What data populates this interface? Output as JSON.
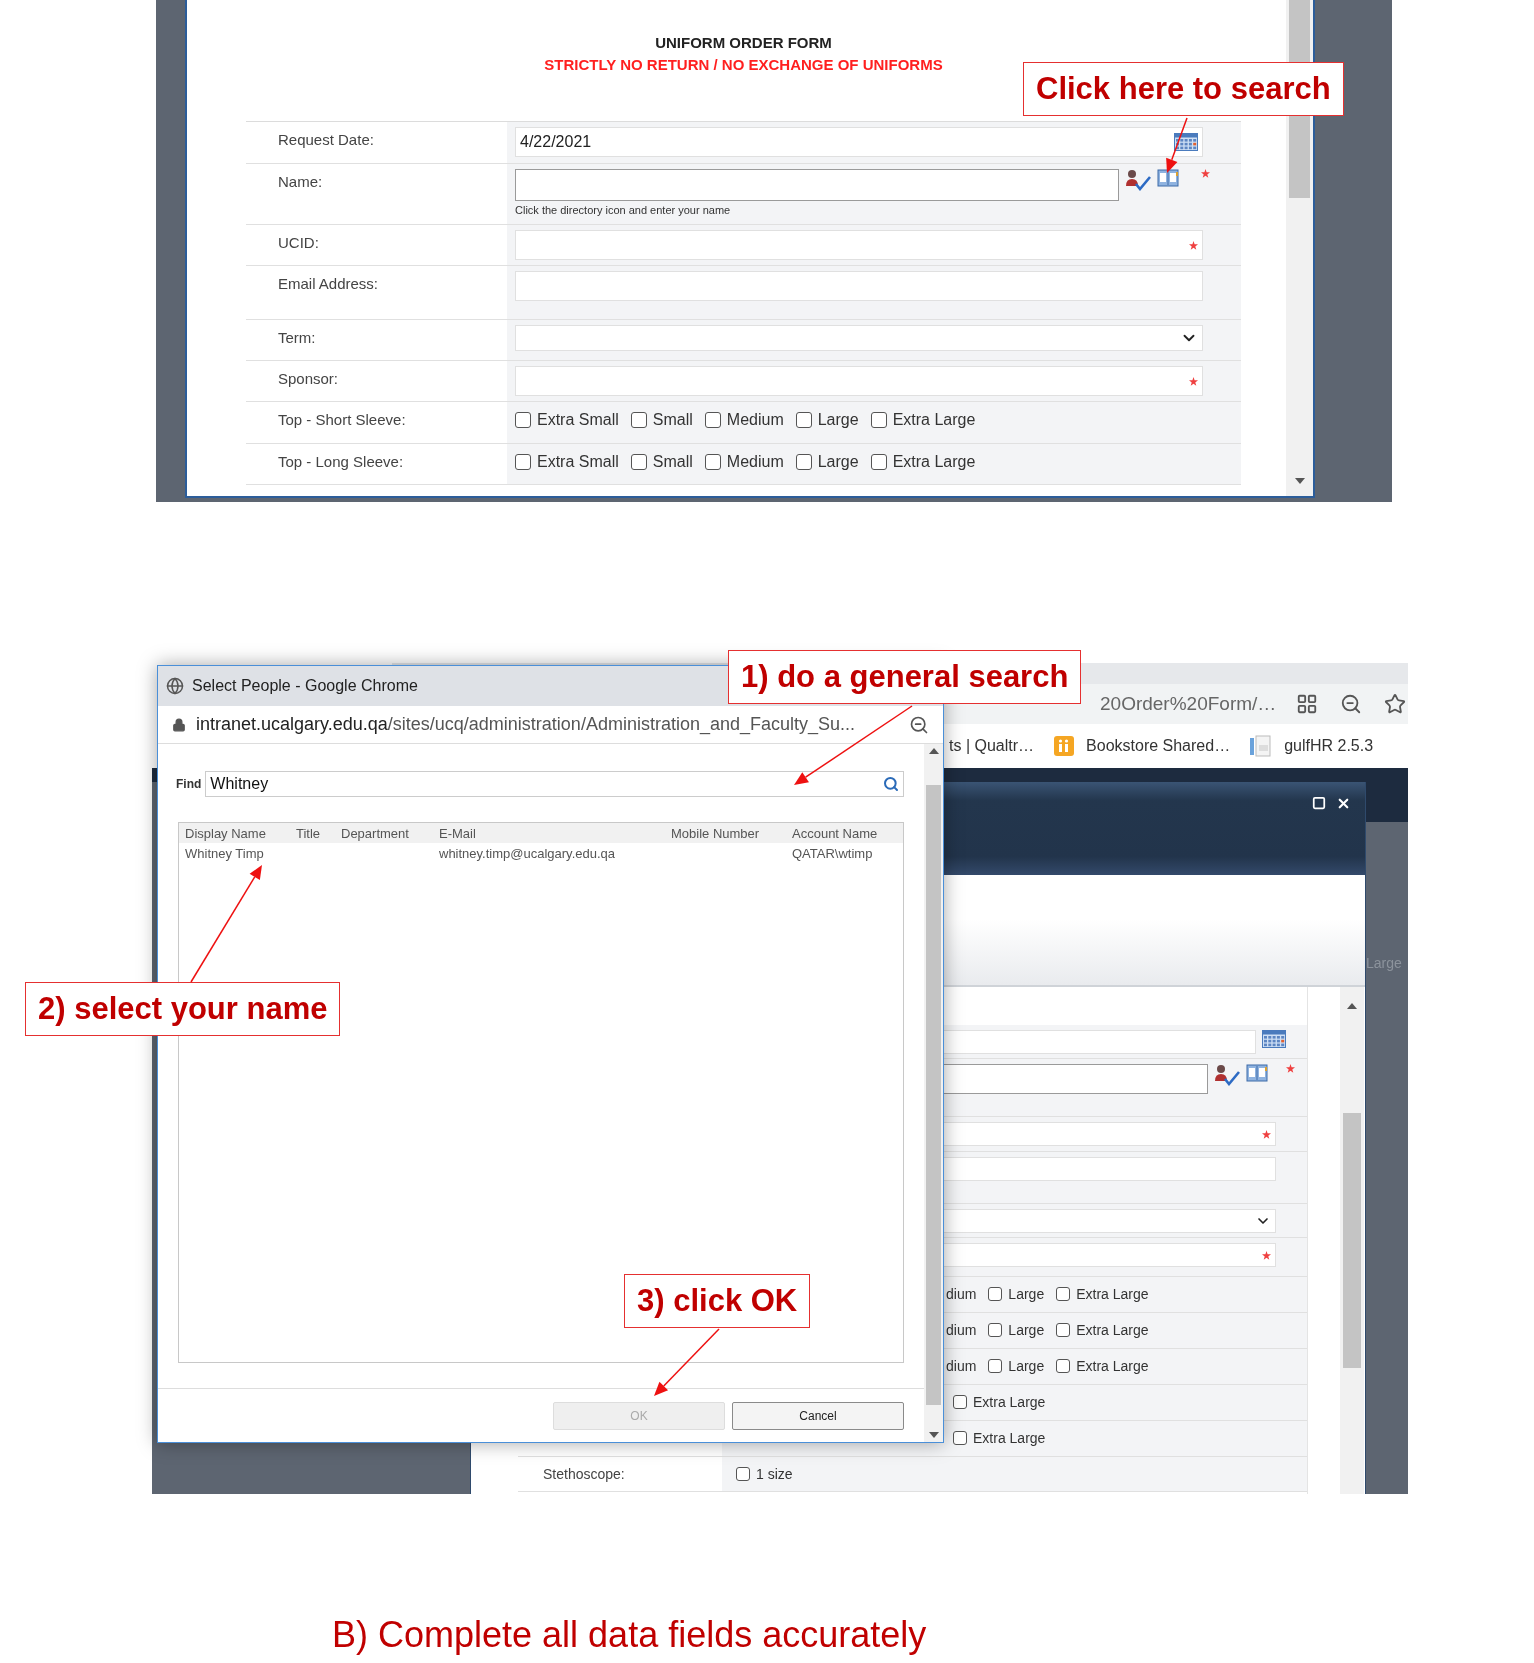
{
  "form": {
    "title": "UNIFORM ORDER FORM",
    "notice": "STRICTLY NO RETURN / NO EXCHANGE OF UNIFORMS",
    "fields": [
      {
        "kind": "date",
        "label": "Request Date:",
        "value": "4/22/2021"
      },
      {
        "kind": "people",
        "label": "Name:",
        "hint": "Click the directory icon and enter your name",
        "required": true
      },
      {
        "kind": "text",
        "label": "UCID:",
        "required": true
      },
      {
        "kind": "text",
        "label": "Email Address:",
        "required": false
      },
      {
        "kind": "select",
        "label": "Term:"
      },
      {
        "kind": "text",
        "label": "Sponsor:",
        "required": true
      },
      {
        "kind": "checkboxes",
        "label": "Top - Short Sleeve:",
        "options": [
          {
            "label": "Extra Small",
            "checked": false
          },
          {
            "label": "Small",
            "checked": false
          },
          {
            "label": "Medium",
            "checked": false
          },
          {
            "label": "Large",
            "checked": false
          },
          {
            "label": "Extra Large",
            "checked": false
          }
        ]
      },
      {
        "kind": "checkboxes",
        "label": "Top - Long Sleeve:",
        "options": [
          {
            "label": "Extra Small",
            "checked": false
          },
          {
            "label": "Small",
            "checked": false
          },
          {
            "label": "Medium",
            "checked": false
          },
          {
            "label": "Large",
            "checked": false
          },
          {
            "label": "Extra Large",
            "checked": false
          }
        ]
      }
    ]
  },
  "background": {
    "address_fragment": "20Order%20Form/…",
    "bookmarks": [
      {
        "label": "ts | Qualtr…",
        "kind": "plain"
      },
      {
        "label": "Bookstore Shared…",
        "kind": "app"
      },
      {
        "label": "gulfHR 2.5.3",
        "kind": "doc"
      }
    ],
    "side_text": "Large",
    "form_rows": [
      {
        "kind": "date"
      },
      {
        "kind": "people",
        "required": true
      },
      {
        "kind": "text",
        "required": true
      },
      {
        "kind": "text",
        "required": false
      },
      {
        "kind": "select"
      },
      {
        "kind": "text",
        "required": true
      },
      {
        "kind": "checkboxes",
        "leading_text": "dium",
        "options": [
          {
            "label": "Large",
            "checked": false
          },
          {
            "label": "Extra Large",
            "checked": false
          }
        ]
      },
      {
        "kind": "checkboxes",
        "leading_text": "dium",
        "options": [
          {
            "label": "Large",
            "checked": false
          },
          {
            "label": "Extra Large",
            "checked": false
          }
        ]
      },
      {
        "kind": "checkboxes",
        "leading_text": "dium",
        "options": [
          {
            "label": "Large",
            "checked": false
          },
          {
            "label": "Extra Large",
            "checked": false
          }
        ]
      },
      {
        "kind": "checkboxes",
        "options": [
          {
            "label": "Extra Large",
            "checked": false
          }
        ]
      },
      {
        "kind": "checkboxes",
        "options": [
          {
            "label": "Extra Large",
            "checked": false
          }
        ]
      },
      {
        "kind": "checkboxes",
        "label": "Stethoscope:",
        "options": [
          {
            "label": "1 size",
            "checked": false
          }
        ]
      }
    ]
  },
  "popup": {
    "title": "Select People - Google Chrome",
    "url_host": "intranet.ucalgary.edu.qa",
    "url_path": "/sites/ucq/administration/Administration_and_Faculty_Su...",
    "find_label": "Find",
    "find_value": "Whitney",
    "columns": [
      "Display Name",
      "Title",
      "Department",
      "E-Mail",
      "Mobile Number",
      "Account Name"
    ],
    "rows": [
      {
        "cells": [
          "Whitney Timp",
          "",
          "",
          "whitney.timp@ucalgary.edu.qa",
          "",
          "QATAR\\wtimp"
        ]
      }
    ],
    "buttons": [
      {
        "label": "OK",
        "disabled": true
      },
      {
        "label": "Cancel",
        "disabled": false
      }
    ]
  },
  "callouts": [
    {
      "text": "Click here to search"
    },
    {
      "text": "1) do a general search"
    },
    {
      "text": "2) select your name"
    },
    {
      "text": "3) click OK"
    }
  ],
  "instruction": "B) Complete all data fields accurately"
}
